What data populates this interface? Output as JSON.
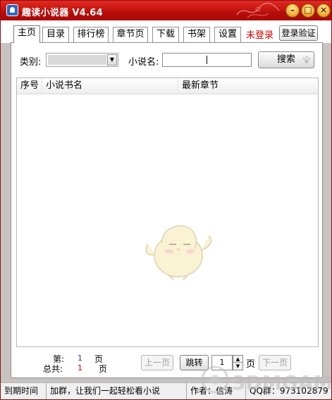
{
  "window": {
    "title": "趣读小说器 V4.64",
    "buttons": {
      "minimize": "–",
      "maximize": "□",
      "close": "×"
    }
  },
  "tabs": [
    "主页",
    "目录",
    "排行榜",
    "章节页",
    "下载",
    "书架",
    "设置"
  ],
  "header": {
    "login_status": "未登录",
    "login_button": "登录验证"
  },
  "search": {
    "category_label": "类别:",
    "category_value": "",
    "name_label": "小说名:",
    "name_value": "",
    "search_button": "搜索"
  },
  "table": {
    "columns": [
      "序号",
      "小说书名",
      "最新章节"
    ],
    "rows": []
  },
  "pager": {
    "current_label": "第:",
    "current_page": "1",
    "page_unit": "页",
    "total_label": "总共:",
    "total_pages": "1",
    "prev_button": "上一页",
    "jump_button": "跳转",
    "jump_value": "1",
    "next_button": "下一页"
  },
  "statusbar": {
    "expire": "到期时间",
    "group": "加群，让我们一起轻松看小说",
    "author": "作者：信涛",
    "qq": "QQ群：973102879"
  },
  "colors": {
    "title_red": "#c8140e",
    "login_red": "#d40000",
    "page_blue": "#1a3a9a",
    "page_red": "#c80000"
  }
}
